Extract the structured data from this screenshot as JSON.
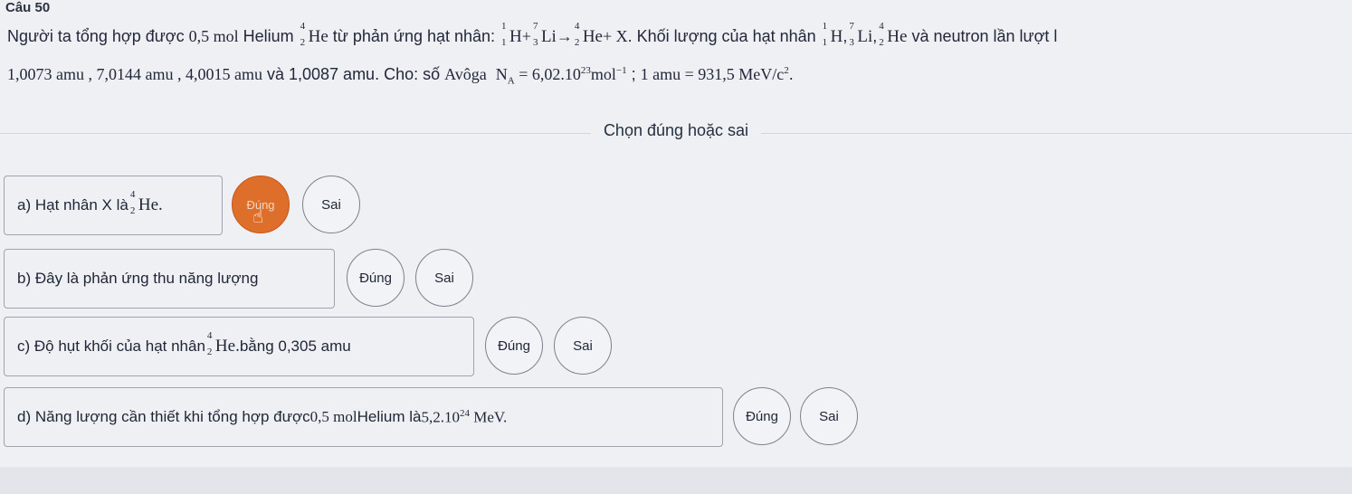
{
  "question": {
    "title": "Câu 50",
    "line1_text": "Người ta tổng hợp được ",
    "amount": "0,5 mol",
    "line1_text2": " Helium ",
    "line1_text3": " từ phản ứng hạt nhân: ",
    "reaction": {
      "plus": "+",
      "arrow": "→",
      "plus_x": "+ X"
    },
    "line1_text4": ". Khối lượng của hạt nhân ",
    "line1_text5": " và neutron lần lượt l",
    "line2_masses": "1,0073 amu ,  7,0144 amu ,  4,0015 amu",
    "line2_text": "  và 1,0087 amu. Cho: số ",
    "line2_avog": "Avôga",
    "line2_na": "N",
    "line2_na_sub": "A",
    "line2_na_val": " = 6,02.10",
    "line2_na_exp": "23",
    "line2_na_unit": "mol",
    "line2_na_unit_exp": "−1",
    "line2_sep": " ;  ",
    "line2_amu": "1 amu = 931,5 MeV/c",
    "line2_amu_exp": "2",
    "line2_end": "."
  },
  "nuclei": {
    "he": {
      "symbol": "He",
      "mass": "4",
      "charge": "2"
    },
    "h": {
      "symbol": "H",
      "mass": "1",
      "charge": "1"
    },
    "li": {
      "symbol": "Li",
      "mass": "7",
      "charge": "3"
    }
  },
  "section_title": "Chọn đúng hoặc sai",
  "statements": {
    "a": {
      "prefix": "a) Hạt nhân X là ",
      "symbol": "He.",
      "mass": "4",
      "charge": "2",
      "true_label": "Đúng",
      "false_label": "Sai"
    },
    "b": {
      "text": "b) Đây là phản ứng thu năng lượng",
      "true_label": "Đúng",
      "false_label": "Sai"
    },
    "c": {
      "prefix": "c) Độ hụt khối của hạt nhân ",
      "symbol": "He.",
      "mass": "4",
      "charge": "2",
      "suffix": " bằng 0,305 amu",
      "true_label": "Đúng",
      "false_label": "Sai"
    },
    "d": {
      "prefix": "d) Năng lượng cần thiết khi tổng hợp được ",
      "amount": "0,5 mol",
      "mid": " Helium là ",
      "value": "5,2.10",
      "exp": "24",
      "unit": " MeV.",
      "true_label": "Đúng",
      "false_label": "Sai"
    }
  },
  "colors": {
    "selected": "#de6f2b",
    "background": "#eef0f4",
    "border": "#9ea4ae"
  }
}
